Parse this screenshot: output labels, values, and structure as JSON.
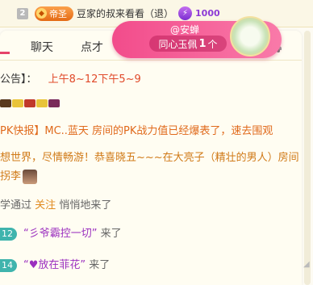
{
  "topbar": {
    "rank_number": "2",
    "badge_label": "帝圣",
    "username_text": "豆家的叔来看看（退）",
    "coin_amount": "1000"
  },
  "tabs": [
    {
      "label": "聊天"
    },
    {
      "label": "点才"
    }
  ],
  "popup": {
    "name": "@安蝉",
    "gift_name": "同心玉佩",
    "gift_count": "1",
    "gift_unit": "个"
  },
  "messages": {
    "notice": {
      "prefix": "公告】：",
      "schedule": "上午8~12下午5~9"
    },
    "pk": "PK快报】MC..蓝天 房间的PK战力值已经爆表了，速去围观",
    "welcome_line1": "想世界，尽情畅游！恭喜晓五~~~在大亮子（精壮的男人）房间",
    "welcome_line2": "拐李",
    "follow": {
      "prefix": "学通过",
      "action": "关注",
      "suffix": "悄悄地来了"
    },
    "join1": {
      "level": "12",
      "name": "“彡爷霸控一切”",
      "verb": "来了"
    },
    "join2": {
      "level": "14",
      "name": "“♥放在菲花”",
      "verb": "来了"
    }
  },
  "colors": {
    "accent_pink": "#f24c8b",
    "notice_red": "#e04a2a",
    "pk_orange": "#e06a1c",
    "level_teal": "#3fb4ad",
    "coin_purple": "#8d3ad6"
  },
  "icons": [
    "rank-badge-icon",
    "emperor-badge-icon",
    "coin-icon",
    "car-icon",
    "jade-pendant-icon",
    "resize-icon"
  ]
}
